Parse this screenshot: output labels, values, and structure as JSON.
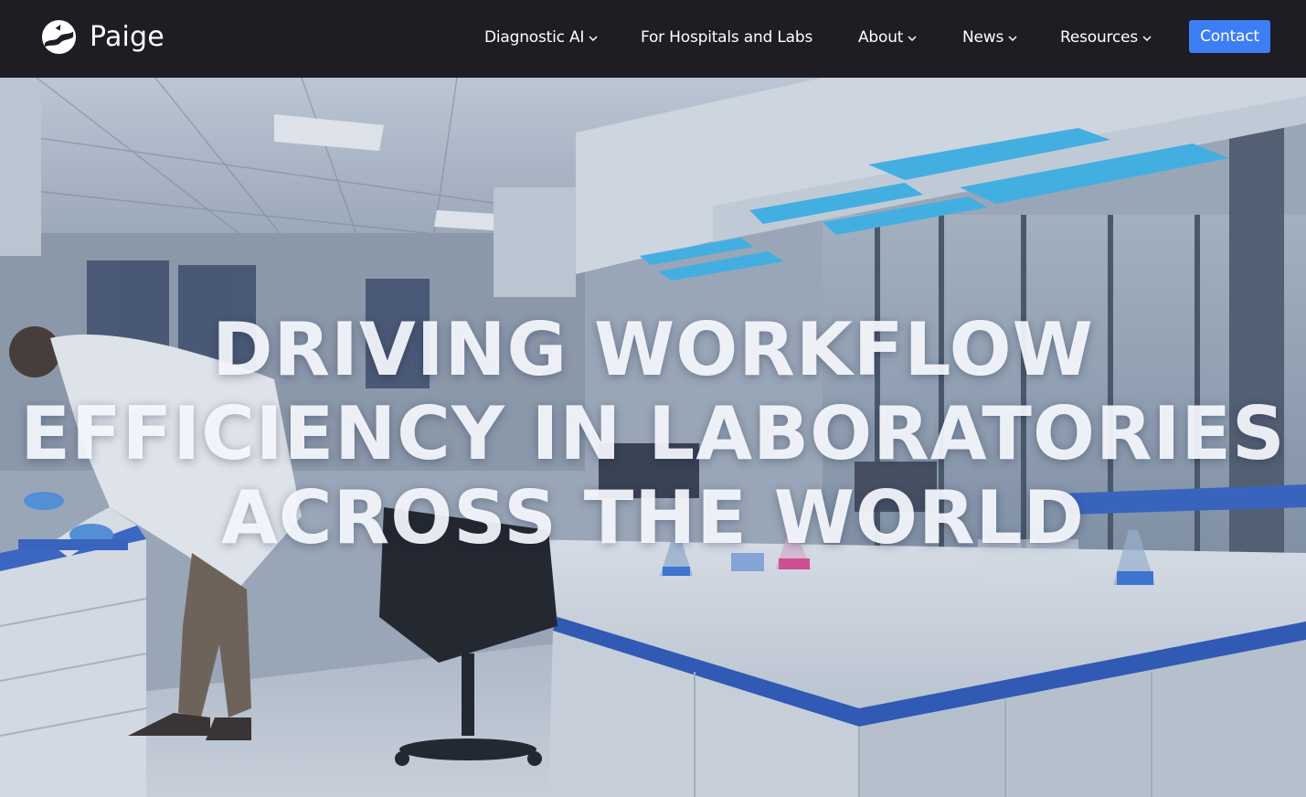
{
  "brand": {
    "name": "Paige",
    "logo_icon": "paige-logo-icon"
  },
  "nav": {
    "items": [
      {
        "label": "Diagnostic AI",
        "has_dropdown": true
      },
      {
        "label": "For Hospitals and Labs",
        "has_dropdown": false
      },
      {
        "label": "About",
        "has_dropdown": true
      },
      {
        "label": "News",
        "has_dropdown": true
      },
      {
        "label": "Resources",
        "has_dropdown": true
      }
    ],
    "contact_label": "Contact"
  },
  "hero": {
    "title_lines": [
      "DRIVING WORKFLOW",
      "EFFICIENCY IN LABORATORIES",
      "ACROSS THE WORLD"
    ]
  },
  "colors": {
    "navbar_bg": "#1d1d23",
    "accent": "#3d7ef6",
    "lab_counter_blue": "#1f4fb8",
    "ceiling_light_blue": "#33b7ee"
  }
}
